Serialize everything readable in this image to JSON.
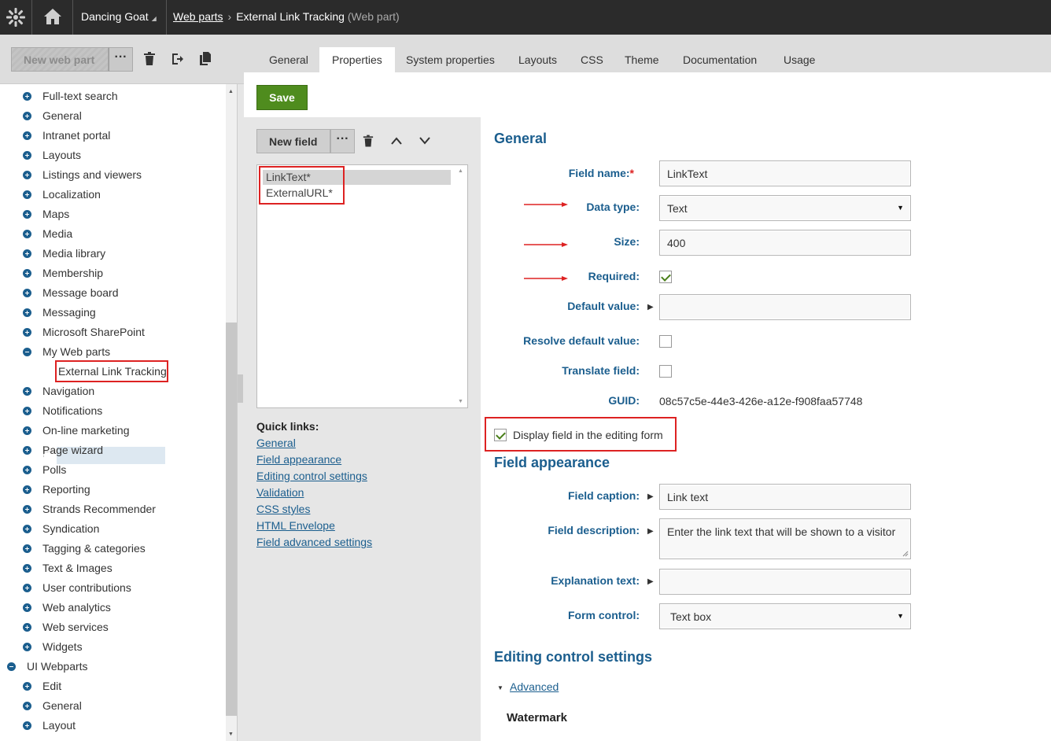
{
  "topbar": {
    "site_name": "Dancing Goat",
    "breadcrumb_link": "Web parts",
    "breadcrumb_current": "External Link Tracking",
    "breadcrumb_type": "(Web part)"
  },
  "left_toolbar": {
    "new_web_part": "New web part",
    "more": "···"
  },
  "tabs": [
    "General",
    "Properties",
    "System properties",
    "Layouts",
    "CSS",
    "Theme",
    "Documentation",
    "Usage"
  ],
  "active_tab": "Properties",
  "tree": {
    "items": [
      "Full-text search",
      "General",
      "Intranet portal",
      "Layouts",
      "Listings and viewers",
      "Localization",
      "Maps",
      "Media",
      "Media library",
      "Membership",
      "Message board",
      "Messaging",
      "Microsoft SharePoint",
      "My Web parts",
      "External Link Tracking",
      "Navigation",
      "Notifications",
      "On-line marketing",
      "Page wizard",
      "Polls",
      "Reporting",
      "Strands Recommender",
      "Syndication",
      "Tagging & categories",
      "Text & Images",
      "User contributions",
      "Web analytics",
      "Web services",
      "Widgets",
      "UI Webparts",
      "Edit",
      "General",
      "Layout"
    ],
    "selected": "External Link Tracking"
  },
  "save_button": "Save",
  "field_toolbar": {
    "new_field": "New field",
    "more": "···"
  },
  "fields": [
    "LinkText*",
    "ExternalURL*"
  ],
  "quick_links": {
    "title": "Quick links:",
    "links": [
      "General",
      "Field appearance",
      "Editing control settings",
      "Validation",
      "CSS styles",
      "HTML Envelope",
      "Field advanced settings"
    ]
  },
  "form": {
    "section_general": "General",
    "field_name_label": "Field name:",
    "required_mark": "*",
    "field_name_value": "LinkText",
    "data_type_label": "Data type:",
    "data_type_value": "Text",
    "size_label": "Size:",
    "size_value": "400",
    "required_label": "Required:",
    "required_checked": true,
    "default_value_label": "Default value:",
    "default_value": "",
    "resolve_default_label": "Resolve default value:",
    "translate_field_label": "Translate field:",
    "guid_label": "GUID:",
    "guid_value": "08c57c5e-44e3-426e-a12e-f908faa57748",
    "display_field_label": "Display field in the editing form",
    "section_appearance": "Field appearance",
    "field_caption_label": "Field caption:",
    "field_caption_value": "Link text",
    "field_description_label": "Field description:",
    "field_description_value": "Enter the link text that will be shown to a visitor",
    "explanation_text_label": "Explanation text:",
    "explanation_text_value": "",
    "form_control_label": "Form control:",
    "form_control_value": "Text box",
    "section_editing": "Editing control settings",
    "advanced_link": "Advanced",
    "watermark_heading": "Watermark"
  },
  "colors": {
    "accent_blue": "#1b5e8e",
    "save_green": "#4f8c1e",
    "highlight_red": "#dd2222",
    "topbar": "#2b2b2b"
  }
}
